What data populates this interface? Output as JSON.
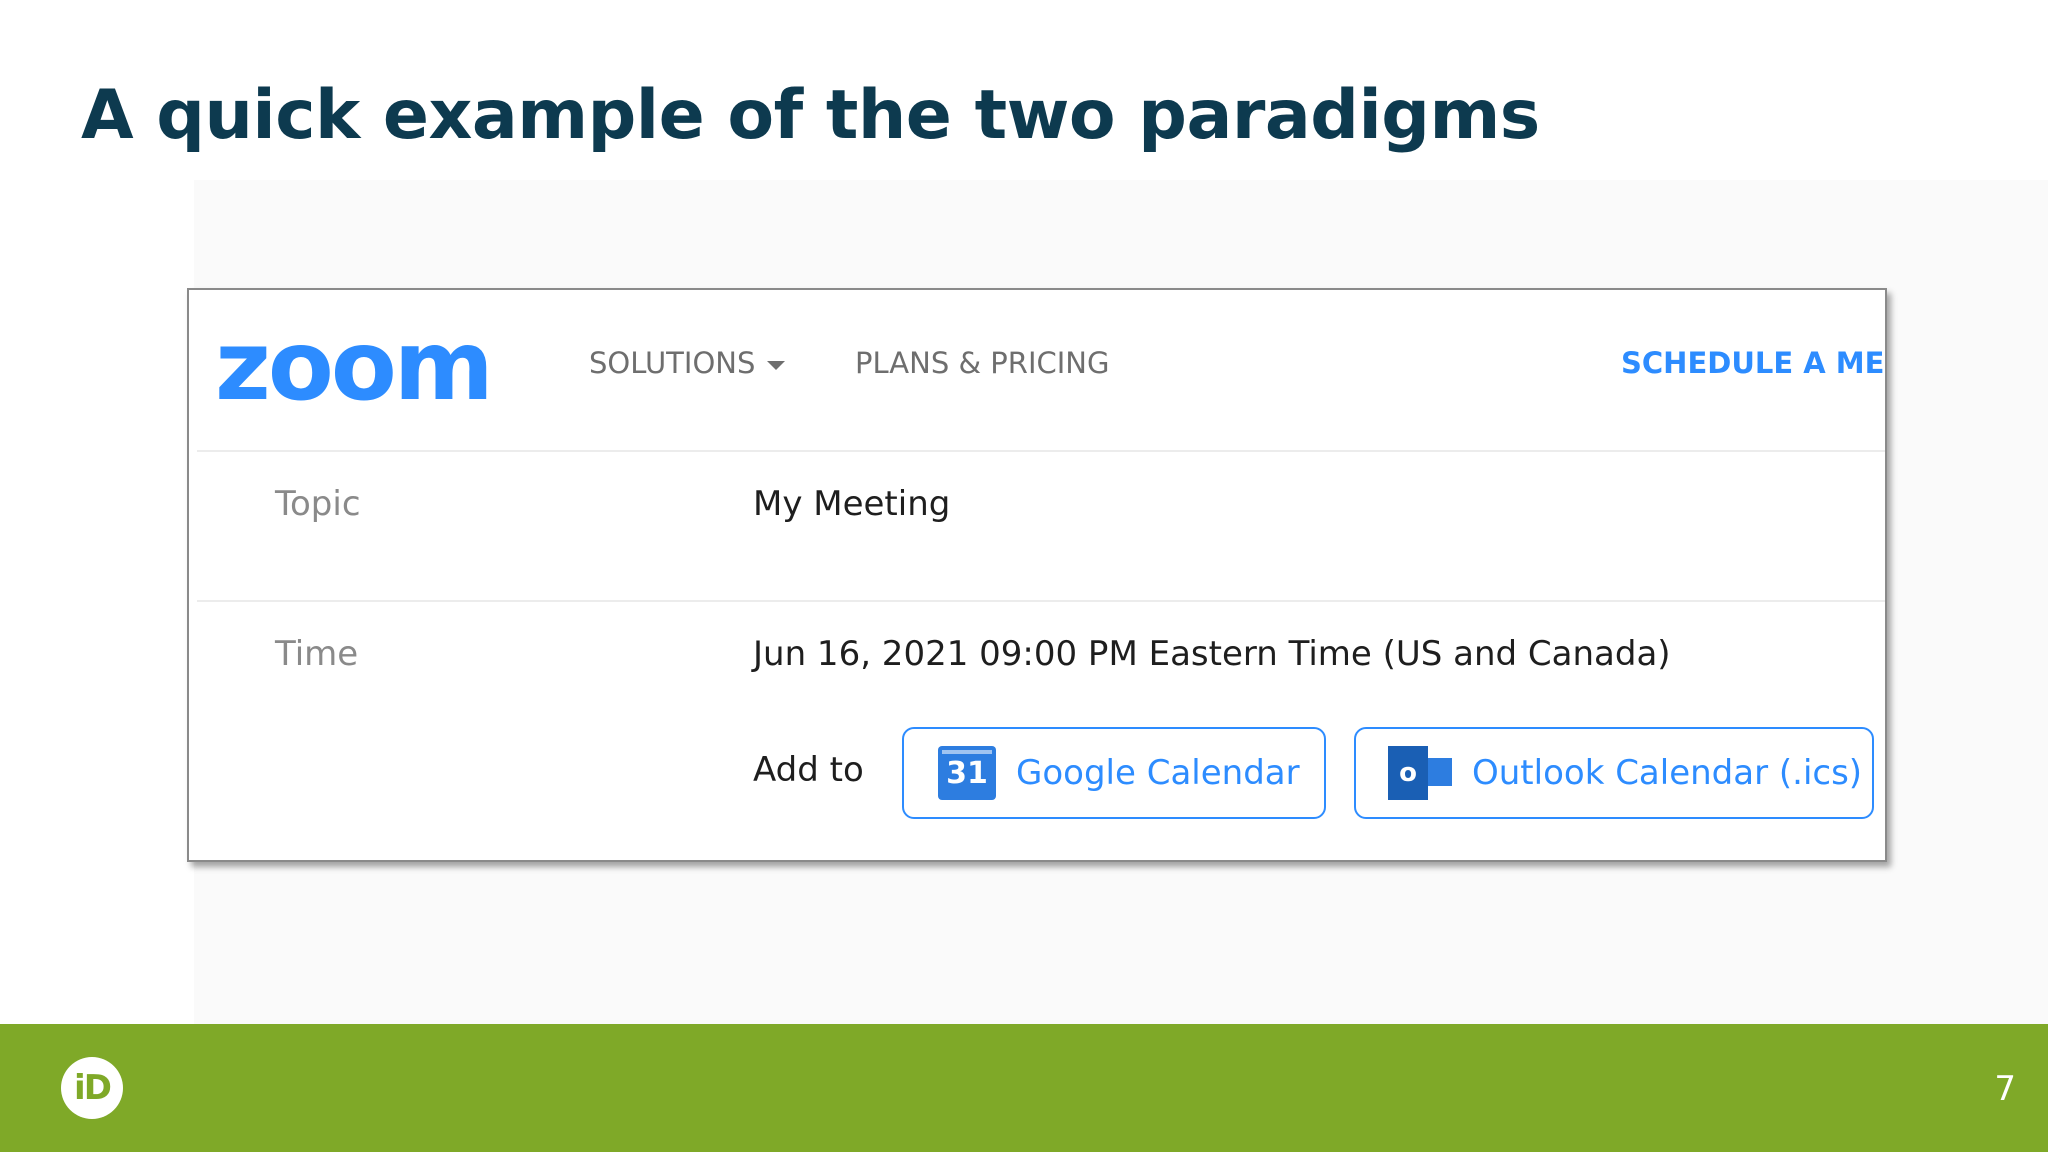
{
  "slide": {
    "title": "A quick example of the two paradigms",
    "page_number": "7",
    "footer_color": "#7fa928",
    "logo_text": "iD",
    "logo_icon": "orcid-icon"
  },
  "zoom_app": {
    "logo": "zoom",
    "brand_color": "#2d8cff",
    "nav": {
      "solutions": "SOLUTIONS",
      "plans_pricing": "PLANS & PRICING",
      "schedule_meeting": "SCHEDULE A MEE"
    },
    "meeting": {
      "topic_label": "Topic",
      "topic_value": "My Meeting",
      "time_label": "Time",
      "time_value": "Jun 16, 2021 09:00 PM Eastern Time (US and Canada)",
      "add_to_label": "Add to",
      "google_calendar": {
        "label": "Google Calendar",
        "icon": "google-calendar-icon",
        "icon_text": "31"
      },
      "outlook_calendar": {
        "label": "Outlook Calendar (.ics)",
        "icon": "outlook-icon",
        "icon_text": "o"
      }
    }
  }
}
